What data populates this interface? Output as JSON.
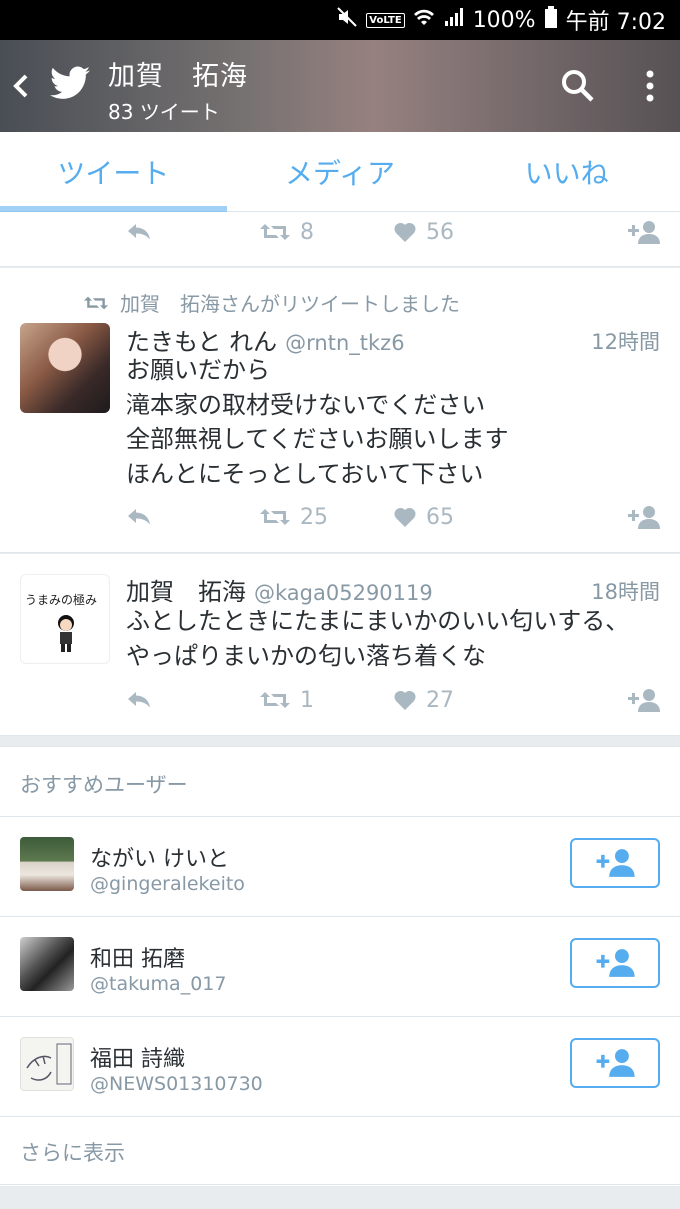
{
  "status_bar": {
    "volte": "VoLTE",
    "battery": "100%",
    "time": "午前 7:02"
  },
  "header": {
    "title": "加賀　拓海",
    "subtitle": "83 ツイート"
  },
  "tabs": [
    {
      "label": "ツイート",
      "active": true
    },
    {
      "label": "メディア",
      "active": false
    },
    {
      "label": "いいね",
      "active": false
    }
  ],
  "top_partial": {
    "retweets": "8",
    "likes": "56"
  },
  "tweets": [
    {
      "retweet_note": "加賀　拓海さんがリツイートしました",
      "name": "たきもと れん",
      "handle": "@rntn_tkz6",
      "time": "12時間",
      "lines": [
        "お願いだから",
        "滝本家の取材受けないでください",
        "全部無視してくださいお願いします",
        "ほんとにそっとしておいて下さい"
      ],
      "retweets": "25",
      "likes": "65"
    },
    {
      "name": "加賀　拓海",
      "handle": "@kaga05290119",
      "time": "18時間",
      "lines": [
        "ふとしたときにたまにまいかのいい匂いする、",
        "やっぱりまいかの匂い落ち着くな"
      ],
      "retweets": "1",
      "likes": "27",
      "avatar_text": "うまみの極み"
    }
  ],
  "recommended": {
    "heading": "おすすめユーザー",
    "users": [
      {
        "name": "ながい けいと",
        "handle": "@gingeralekeito"
      },
      {
        "name": "和田 拓磨",
        "handle": "@takuma_017"
      },
      {
        "name": "福田 詩織",
        "handle": "@NEWS01310730"
      }
    ],
    "more": "さらに表示"
  },
  "colors": {
    "accent": "#55acee",
    "muted": "#8899a6",
    "icon_gray": "#aab8c2"
  }
}
